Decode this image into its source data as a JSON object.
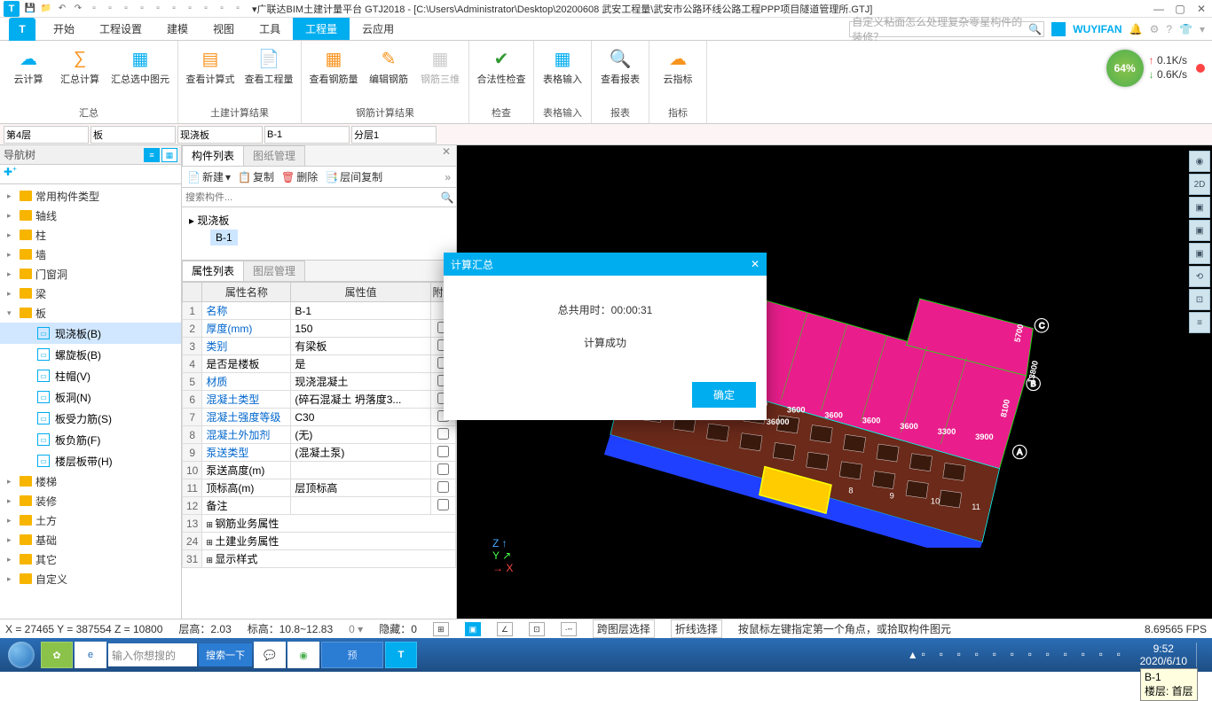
{
  "titleBar": {
    "title": "▾广联达BIM土建计量平台 GTJ2018 - [C:\\Users\\Administrator\\Desktop\\20200608 武安工程量\\武安市公路环线公路工程PPP项目隧道管理所.GTJ]"
  },
  "menuTabs": {
    "items": [
      "开始",
      "工程设置",
      "建模",
      "视图",
      "工具",
      "工程量",
      "云应用"
    ],
    "active": 5,
    "searchPlaceholder": "自定义粘面怎么处理复杂零星构件的装修？",
    "user": "WUYIFAN"
  },
  "ribbon": {
    "groups": [
      {
        "name": "汇总",
        "items": [
          {
            "label": "云计算",
            "ico": "☁"
          },
          {
            "label": "汇总计算",
            "ico": "∑"
          },
          {
            "label": "汇总选中图元",
            "ico": "▦"
          }
        ]
      },
      {
        "name": "土建计算结果",
        "items": [
          {
            "label": "查看计算式",
            "ico": "▤"
          },
          {
            "label": "查看工程量",
            "ico": "📄"
          }
        ]
      },
      {
        "name": "钢筋计算结果",
        "items": [
          {
            "label": "查看钢筋量",
            "ico": "▦"
          },
          {
            "label": "编辑钢筋",
            "ico": "✎"
          },
          {
            "label": "钢筋三维",
            "ico": "▦",
            "disabled": true
          }
        ]
      },
      {
        "name": "检查",
        "items": [
          {
            "label": "合法性检查",
            "ico": "✔"
          }
        ]
      },
      {
        "name": "表格输入",
        "items": [
          {
            "label": "表格输入",
            "ico": "▦"
          }
        ]
      },
      {
        "name": "报表",
        "items": [
          {
            "label": "查看报表",
            "ico": "🔍"
          }
        ]
      },
      {
        "name": "指标",
        "items": [
          {
            "label": "云指标",
            "ico": "☁"
          }
        ]
      }
    ],
    "net": {
      "pct": "64%",
      "up": "0.1K/s",
      "dn": "0.6K/s"
    }
  },
  "filters": {
    "floor": "第4层",
    "cat": "板",
    "sub": "现浇板",
    "code": "B-1",
    "layer": "分层1"
  },
  "navTree": {
    "title": "导航树",
    "roots": [
      {
        "label": "常用构件类型"
      },
      {
        "label": "轴线"
      },
      {
        "label": "柱"
      },
      {
        "label": "墙"
      },
      {
        "label": "门窗洞"
      },
      {
        "label": "梁"
      },
      {
        "label": "板",
        "children": [
          {
            "label": "现浇板(B)",
            "active": true
          },
          {
            "label": "螺旋板(B)"
          },
          {
            "label": "柱帽(V)"
          },
          {
            "label": "板洞(N)"
          },
          {
            "label": "板受力筋(S)"
          },
          {
            "label": "板负筋(F)"
          },
          {
            "label": "楼层板带(H)"
          }
        ]
      },
      {
        "label": "楼梯"
      },
      {
        "label": "装修"
      },
      {
        "label": "土方"
      },
      {
        "label": "基础"
      },
      {
        "label": "其它"
      },
      {
        "label": "自定义"
      }
    ]
  },
  "compPanel": {
    "tabs": [
      "构件列表",
      "图纸管理"
    ],
    "toolbar": {
      "new": "新建",
      "copy": "复制",
      "del": "删除",
      "layerCopy": "层间复制"
    },
    "searchPlaceholder": "搜索构件...",
    "treeRoot": "现浇板",
    "treeLeaf": "B-1"
  },
  "propPanel": {
    "tabs": [
      "属性列表",
      "图层管理"
    ],
    "headers": [
      "",
      "属性名称",
      "属性值",
      "附加"
    ],
    "rows": [
      {
        "n": "1",
        "name": "名称",
        "link": true,
        "val": "B-1",
        "chk": false
      },
      {
        "n": "2",
        "name": "厚度(mm)",
        "link": true,
        "val": "150",
        "chk": true
      },
      {
        "n": "3",
        "name": "类别",
        "link": true,
        "val": "有梁板",
        "chk": true
      },
      {
        "n": "4",
        "name": "是否是楼板",
        "val": "是",
        "chk": true
      },
      {
        "n": "5",
        "name": "材质",
        "link": true,
        "val": "现浇混凝土",
        "chk": true
      },
      {
        "n": "6",
        "name": "混凝土类型",
        "link": true,
        "val": "(碎石混凝土 坍落度3...",
        "chk": true
      },
      {
        "n": "7",
        "name": "混凝土强度等级",
        "link": true,
        "val": "C30",
        "chk": true
      },
      {
        "n": "8",
        "name": "混凝土外加剂",
        "link": true,
        "val": "(无)",
        "chk": true
      },
      {
        "n": "9",
        "name": "泵送类型",
        "link": true,
        "val": "(混凝土泵)",
        "chk": true
      },
      {
        "n": "10",
        "name": "泵送高度(m)",
        "val": "",
        "chk": true
      },
      {
        "n": "11",
        "name": "顶标高(m)",
        "val": "层顶标高",
        "chk": true
      },
      {
        "n": "12",
        "name": "备注",
        "val": "",
        "chk": true
      },
      {
        "n": "13",
        "name": "钢筋业务属性",
        "collapse": true
      },
      {
        "n": "24",
        "name": "土建业务属性",
        "collapse": true
      },
      {
        "n": "31",
        "name": "显示样式",
        "collapse": true
      }
    ]
  },
  "viewport": {
    "tooltip": {
      "line1": "B-1",
      "line2": "楼层: 首层"
    },
    "dims": [
      "3600",
      "3600",
      "3600",
      "3600",
      "3600",
      "3600",
      "3600",
      "36000",
      "3600",
      "3600",
      "3300",
      "3900"
    ],
    "sideDims": [
      "5700",
      "8100",
      "13800"
    ],
    "axisLabels": [
      "A",
      "B",
      "C"
    ],
    "gridNums": [
      "8",
      "9",
      "10",
      "11"
    ]
  },
  "dialog": {
    "title": "计算汇总",
    "msg1": "总共用时：00:00:31",
    "msg2": "计算成功",
    "ok": "确定"
  },
  "statusBar": {
    "coord": "X = 27465 Y = 387554 Z = 10800",
    "floor": "层高：2.03",
    "elev": "标高：10.8~12.83",
    "hide": "隐藏：0",
    "modes": [
      "跨图层选择",
      "折线选择"
    ],
    "hint": "按鼠标左键指定第一个角点，或拾取构件图元",
    "fps": "8.69565 FPS"
  },
  "taskbar": {
    "searchPlaceholder": "输入你想搜的",
    "searchBtn": "搜索一下",
    "time": "9:52",
    "date": "2020/6/10"
  }
}
